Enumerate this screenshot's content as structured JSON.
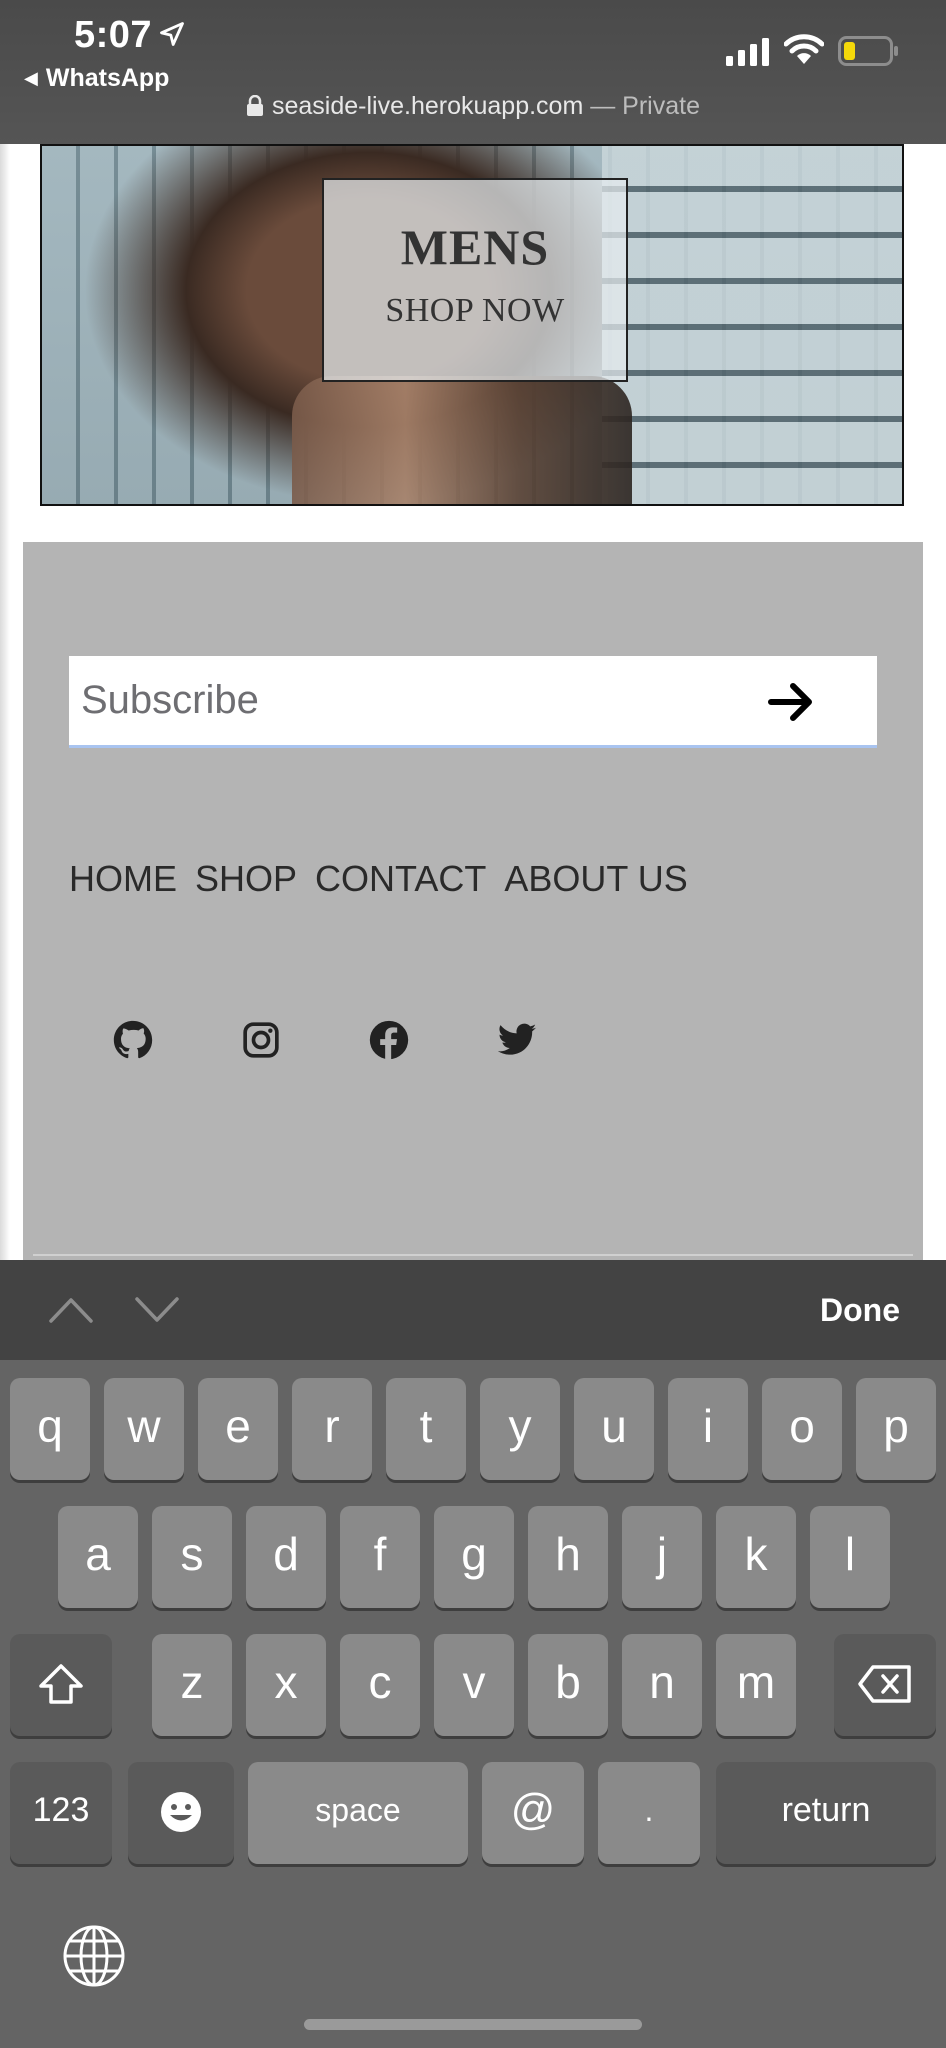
{
  "status_bar": {
    "time": "5:07",
    "back_app": "WhatsApp",
    "url": "seaside-live.herokuapp.com",
    "url_suffix": " — Private"
  },
  "hero": {
    "title": "MENS",
    "cta": "SHOP NOW"
  },
  "footer": {
    "subscribe_placeholder": "Subscribe",
    "nav": [
      "HOME",
      "SHOP",
      "CONTACT",
      "ABOUT US"
    ],
    "social_icons": [
      "github-icon",
      "instagram-icon",
      "facebook-icon",
      "twitter-icon"
    ]
  },
  "keyboard": {
    "done_label": "Done",
    "row1": [
      "q",
      "w",
      "e",
      "r",
      "t",
      "y",
      "u",
      "i",
      "o",
      "p"
    ],
    "row2": [
      "a",
      "s",
      "d",
      "f",
      "g",
      "h",
      "j",
      "k",
      "l"
    ],
    "row3": [
      "z",
      "x",
      "c",
      "v",
      "b",
      "n",
      "m"
    ],
    "numbers_label": "123",
    "space_label": "space",
    "at_label": "@",
    "dot_label": ".",
    "return_label": "return"
  }
}
